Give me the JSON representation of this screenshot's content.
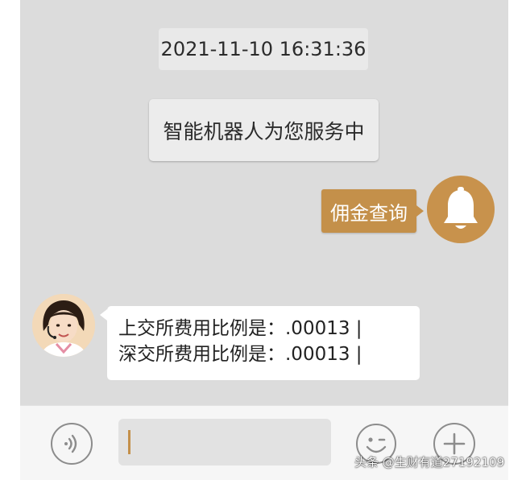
{
  "chat": {
    "timestamp": "2021-11-10 16:31:36",
    "system_message": "智能机器人为您服务中",
    "outgoing_message": "佣金查询",
    "reply_lines": [
      "上交所费用比例是：.00013 |",
      "深交所费用比例是：.00013 |"
    ]
  },
  "input_bar": {
    "text_value": "",
    "icons": {
      "voice": "voice-icon",
      "emoji": "emoji-icon",
      "more": "plus-icon"
    }
  },
  "watermark": "头条 @生财有道27192109",
  "colors": {
    "accent": "#c4904a",
    "chat_background": "#dcdcdc",
    "incoming_bubble": "#ffffff",
    "outgoing_text": "#ffffff"
  }
}
